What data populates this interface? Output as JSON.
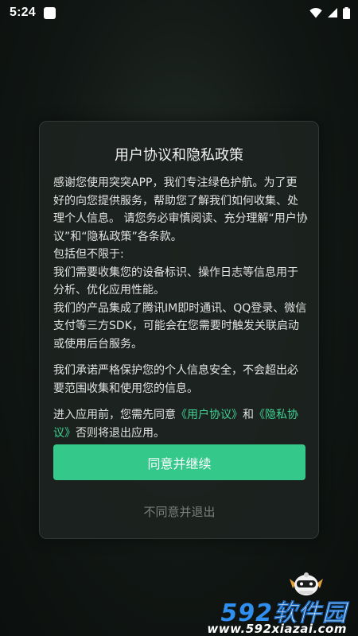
{
  "status_bar": {
    "time": "5:24",
    "icons": [
      "notification-box-icon",
      "wifi-icon",
      "cell-signal-icon",
      "battery-icon"
    ]
  },
  "dialog": {
    "title": "用户协议和隐私政策",
    "paragraph1": "感谢您使用突突APP，我们专注绿色护航。为了更好的向您提供服务，帮助您了解我们如何收集、处理个人信息。 请您务必审慎阅读、充分理解“用户协议”和“隐私政策”各条款。",
    "line_include": "包括但不限于:",
    "line_collect": "我们需要收集您的设备标识、操作日志等信息用于分析、优化应用性能。",
    "line_sdk": "我们的产品集成了腾讯IM即时通讯、QQ登录、微信支付等三方SDK，可能会在您需要时触发关联启动或使用后台服务。",
    "paragraph2": "我们承诺严格保护您的个人信息安全，不会超出必要范围收集和使用您的信息。",
    "consent_prefix": "进入应用前，您需先同意",
    "user_agreement_link": "《用户协议》",
    "consent_and": "和",
    "privacy_link": "《隐私协议》",
    "consent_suffix": "否则将退出应用。",
    "agree_button": "同意并继续",
    "reject_button": "不同意并退出"
  },
  "watermark": {
    "number": "592",
    "name": "软件园",
    "url": "www.592xiazai.com"
  },
  "colors": {
    "accent_green": "#34c98b",
    "link_green": "#3fd093",
    "dialog_bg": "#1c221f",
    "watermark_blue": "#2f8ff0"
  }
}
